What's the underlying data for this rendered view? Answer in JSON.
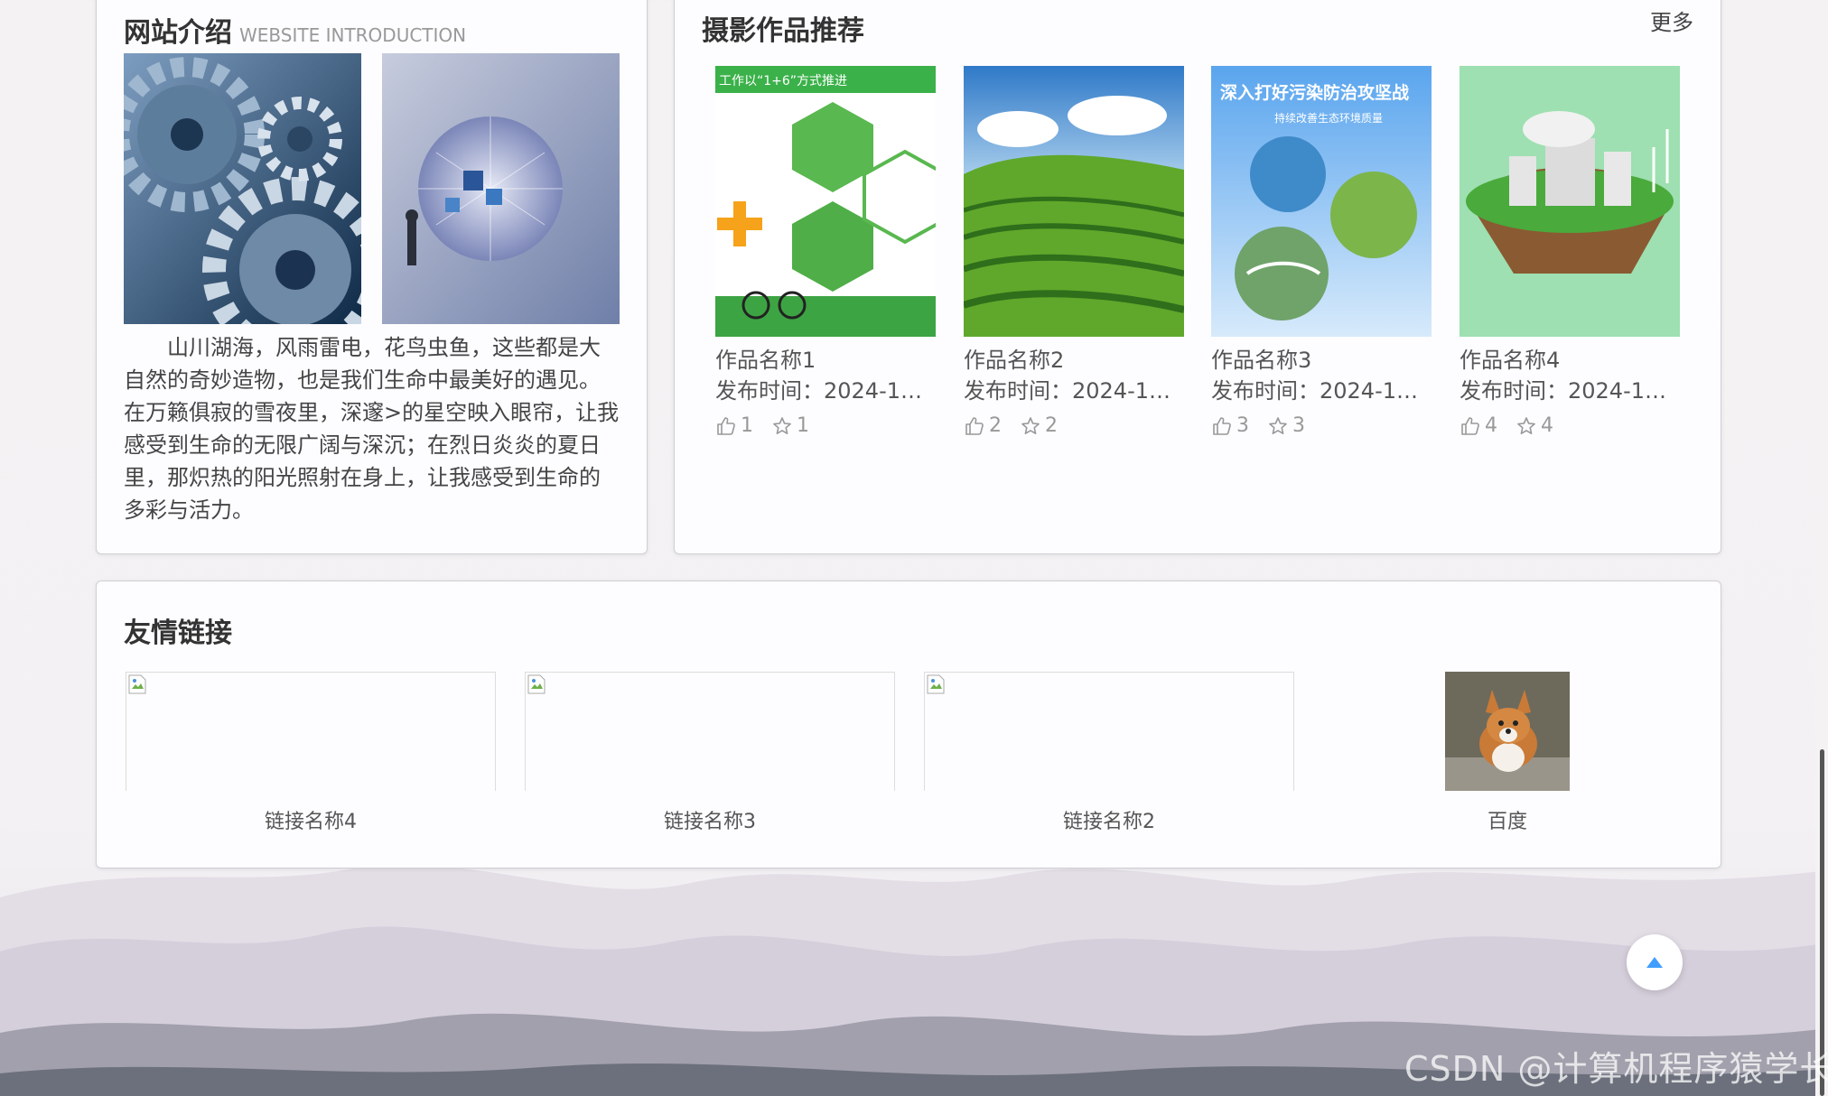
{
  "intro": {
    "title_zh": "网站介绍",
    "title_en": "WEBSITE INTRODUCTION",
    "text": "山川湖海，风雨雷电，花鸟虫鱼，这些都是大自然的奇妙造物，也是我们生命中最美好的遇见。在万籁俱寂的雪夜里，深邃>的星空映入眼帘，让我感受到生命的无限广阔与深沉；在烈日炎炎的夏日里，那炽热的阳光照射在身上，让我感受到生命的多彩与活力。"
  },
  "works": {
    "title": "摄影作品推荐",
    "more": "更多",
    "items": [
      {
        "name": "作品名称1",
        "date": "发布时间：2024-11-...",
        "likes": "1",
        "favs": "1"
      },
      {
        "name": "作品名称2",
        "date": "发布时间：2024-11-...",
        "likes": "2",
        "favs": "2"
      },
      {
        "name": "作品名称3",
        "date": "发布时间：2024-11-...",
        "likes": "3",
        "favs": "3"
      },
      {
        "name": "作品名称4",
        "date": "发布时间：2024-11-...",
        "likes": "4",
        "favs": "4"
      }
    ],
    "thumb1_text": "工作以“1+6”方式推进",
    "thumb3_text": "深入打好污染防治攻坚战",
    "thumb3_sub": "持续改善生态环境质量"
  },
  "links": {
    "title": "友情链接",
    "items": [
      {
        "name": "链接名称4"
      },
      {
        "name": "链接名称3"
      },
      {
        "name": "链接名称2"
      },
      {
        "name": "百度"
      }
    ]
  },
  "watermark": "CSDN @计算机程序猿学长"
}
